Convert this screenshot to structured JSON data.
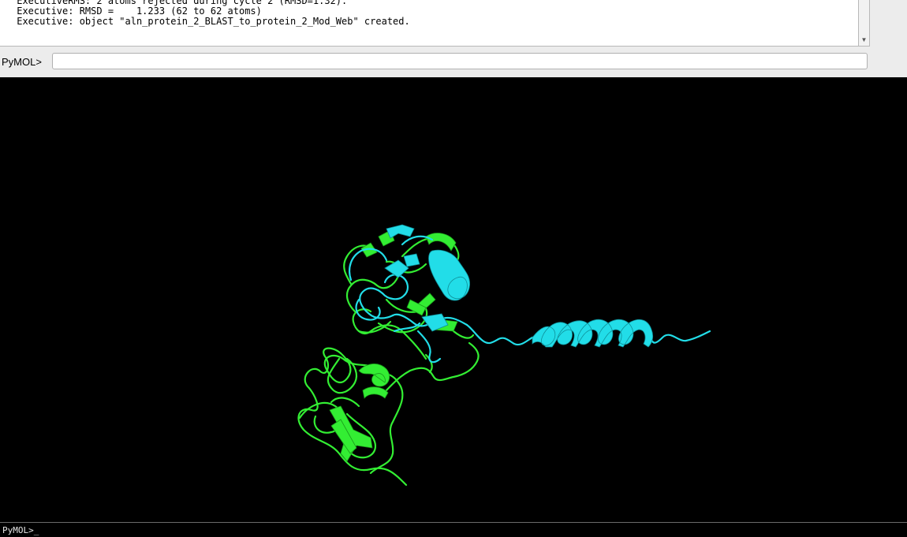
{
  "log": {
    "lines": [
      " ExecutiveRMS: 2 atoms rejected during cycle 2 (RMSD=1.32).",
      " Executive: RMSD =    1.233 (62 to 62 atoms)",
      " Executive: object \"aln_protein_2_BLAST_to_protein_2_Mod_Web\" created."
    ]
  },
  "command": {
    "prompt_label": "PyMOL>",
    "value": "",
    "placeholder": ""
  },
  "viewer": {
    "background_color": "#000000",
    "structures": [
      {
        "name": "protein_2_BLAST",
        "color": "#33ee33",
        "icon": "green-cartoon"
      },
      {
        "name": "protein_2_Mod_Web",
        "color": "#22dde8",
        "icon": "cyan-cartoon"
      }
    ]
  },
  "bottom_command": {
    "prompt": "PyMOL>_"
  }
}
